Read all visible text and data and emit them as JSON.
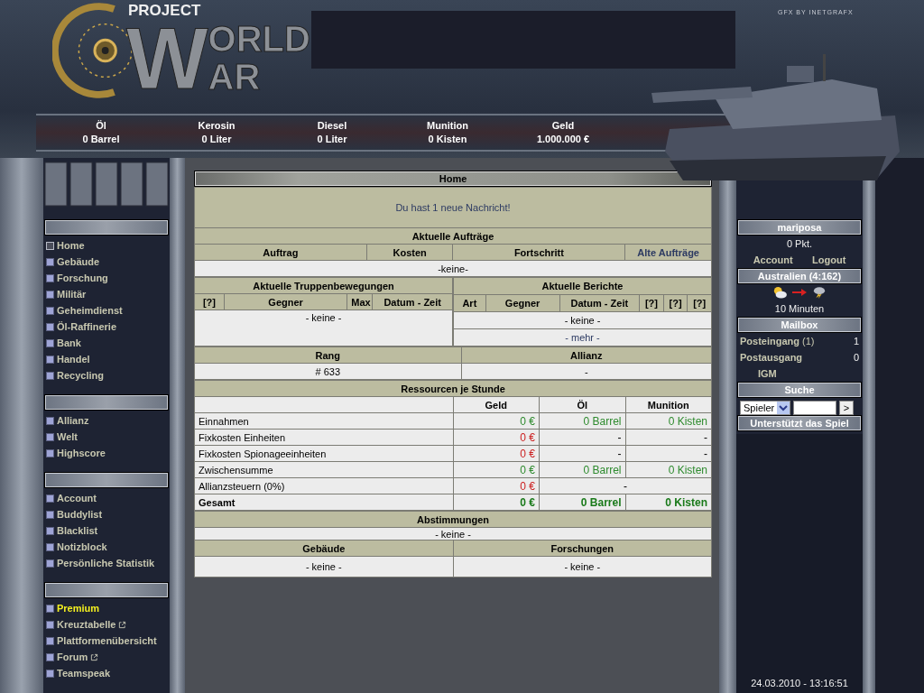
{
  "header": {
    "logo": {
      "small": "PROJECT",
      "initial": "W",
      "line_1": "ORLD",
      "line_2": "AR"
    },
    "credit": "GFX BY INETGRAFX"
  },
  "resources": [
    {
      "label": "Öl",
      "value": "0 Barrel"
    },
    {
      "label": "Kerosin",
      "value": "0 Liter"
    },
    {
      "label": "Diesel",
      "value": "0 Liter"
    },
    {
      "label": "Munition",
      "value": "0 Kisten"
    },
    {
      "label": "Geld",
      "value": "1.000.000 €"
    }
  ],
  "left_menu": [
    {
      "items": [
        {
          "label": "Home",
          "selected": true,
          "highlighted": false,
          "external": false
        },
        {
          "label": "Gebäude",
          "selected": false,
          "highlighted": false,
          "external": false
        },
        {
          "label": "Forschung",
          "selected": false,
          "highlighted": false,
          "external": false
        },
        {
          "label": "Militär",
          "selected": false,
          "highlighted": false,
          "external": false
        },
        {
          "label": "Geheimdienst",
          "selected": false,
          "highlighted": false,
          "external": false
        },
        {
          "label": "Öl-Raffinerie",
          "selected": false,
          "highlighted": false,
          "external": false
        },
        {
          "label": "Bank",
          "selected": false,
          "highlighted": false,
          "external": false
        },
        {
          "label": "Handel",
          "selected": false,
          "highlighted": false,
          "external": false
        },
        {
          "label": "Recycling",
          "selected": false,
          "highlighted": false,
          "external": false
        }
      ]
    },
    {
      "items": [
        {
          "label": "Allianz",
          "selected": false,
          "highlighted": false,
          "external": false
        },
        {
          "label": "Welt",
          "selected": false,
          "highlighted": false,
          "external": false
        },
        {
          "label": "Highscore",
          "selected": false,
          "highlighted": false,
          "external": false
        }
      ]
    },
    {
      "items": [
        {
          "label": "Account",
          "selected": false,
          "highlighted": false,
          "external": false
        },
        {
          "label": "Buddylist",
          "selected": false,
          "highlighted": false,
          "external": false
        },
        {
          "label": "Blacklist",
          "selected": false,
          "highlighted": false,
          "external": false
        },
        {
          "label": "Notizblock",
          "selected": false,
          "highlighted": false,
          "external": false
        },
        {
          "label": "Persönliche Statistik",
          "selected": false,
          "highlighted": false,
          "external": false
        }
      ]
    },
    {
      "items": [
        {
          "label": "Premium",
          "selected": false,
          "highlighted": true,
          "external": false
        },
        {
          "label": "Kreuztabelle",
          "selected": false,
          "highlighted": false,
          "external": true
        },
        {
          "label": "Plattformenübersicht",
          "selected": false,
          "highlighted": false,
          "external": false
        },
        {
          "label": "Forum",
          "selected": false,
          "highlighted": false,
          "external": true
        },
        {
          "label": "Teamspeak",
          "selected": false,
          "highlighted": false,
          "external": false
        }
      ]
    }
  ],
  "main": {
    "title": "Home",
    "notice": "Du hast 1 neue Nachricht!",
    "orders": {
      "title": "Aktuelle Aufträge",
      "columns": [
        "Auftrag",
        "Kosten",
        "Fortschritt"
      ],
      "link": "Alte Aufträge",
      "empty": "-keine-"
    },
    "movements": {
      "title": "Aktuelle Truppenbewegungen",
      "columns": [
        "[?]",
        "Gegner",
        "Max",
        "Datum - Zeit"
      ],
      "empty": "- keine -"
    },
    "reports": {
      "title": "Aktuelle Berichte",
      "columns": [
        "Art",
        "Gegner",
        "Datum - Zeit",
        "[?]",
        "[?]",
        "[?]"
      ],
      "empty": "- keine -",
      "more": "- mehr -"
    },
    "rank": {
      "title": "Rang",
      "value": "# 633"
    },
    "alliance": {
      "title": "Allianz",
      "value": "-"
    },
    "resources": {
      "title": "Ressourcen je Stunde",
      "columns": [
        "Geld",
        "Öl",
        "Munition"
      ],
      "rows": [
        {
          "label": "Einnahmen",
          "kind": "normal",
          "cells": [
            {
              "text": "0 €",
              "color": "#2e8b2e"
            },
            {
              "text": "0 Barrel",
              "color": "#2e8b2e"
            },
            {
              "text": "0 Kisten",
              "color": "#2e8b2e"
            }
          ]
        },
        {
          "label": "Fixkosten Einheiten",
          "kind": "normal",
          "cells": [
            {
              "text": "0 €",
              "color": "#cc2222"
            },
            {
              "text": "-"
            },
            {
              "text": "-"
            }
          ]
        },
        {
          "label": "Fixkosten Spionageeinheiten",
          "kind": "normal",
          "cells": [
            {
              "text": "0 €",
              "color": "#cc2222"
            },
            {
              "text": "-"
            },
            {
              "text": "-"
            }
          ]
        },
        {
          "label": "Zwischensumme",
          "kind": "normal",
          "cells": [
            {
              "text": "0 €",
              "color": "#2e8b2e"
            },
            {
              "text": "0 Barrel",
              "color": "#2e8b2e"
            },
            {
              "text": "0 Kisten",
              "color": "#2e8b2e"
            }
          ]
        },
        {
          "label": "Allianzsteuern (0%)",
          "kind": "normal",
          "cells": [
            {
              "text": "0 €",
              "color": "#cc2222"
            },
            {
              "text": "-",
              "colspan": 2
            }
          ]
        },
        {
          "label": "Gesamt",
          "kind": "total",
          "cells": [
            {
              "text": "0 €",
              "color": "#1a7a1a"
            },
            {
              "text": "0 Barrel",
              "color": "#1a7a1a"
            },
            {
              "text": "0 Kisten",
              "color": "#1a7a1a"
            }
          ]
        }
      ]
    },
    "polls": {
      "title": "Abstimmungen",
      "empty": "- keine -"
    },
    "queues": [
      {
        "title": "Gebäude",
        "empty": "- keine -"
      },
      {
        "title": "Forschungen",
        "empty": "- keine -"
      }
    ]
  },
  "user": {
    "name": "mariposa",
    "points": "0 Pkt.",
    "links": [
      "Account",
      "Logout"
    ]
  },
  "weather": {
    "title": "Australien (4:162)",
    "time": "10 Minuten"
  },
  "mailbox": {
    "title": "Mailbox",
    "rows": [
      {
        "label": "**Posteingang** (1)",
        "count": "1"
      },
      {
        "label": "**Postausgang**",
        "count": "0"
      }
    ],
    "link": "IGM"
  },
  "search": {
    "title": "Suche",
    "scope": "Spieler",
    "button": ">"
  },
  "support": {
    "title": "Unterstützt das Spiel"
  },
  "clock": "24.03.2010 - 13:16:51"
}
